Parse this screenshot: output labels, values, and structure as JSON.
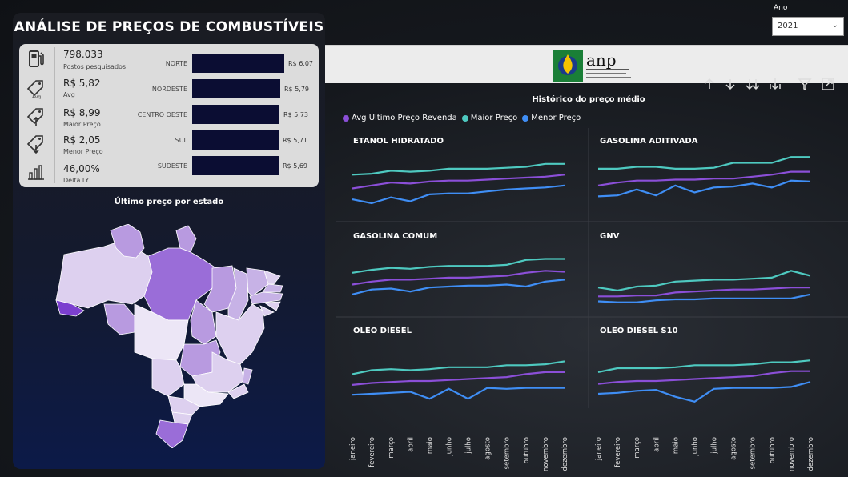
{
  "header": {
    "title": "ANÁLISE DE PREÇOS DE COMBUSTÍVEIS"
  },
  "year_filter": {
    "label": "Ano",
    "selected": "2021"
  },
  "kpis": [
    {
      "value": "798.033",
      "label": "Postos pesquisados",
      "icon": "fuel-pump-icon"
    },
    {
      "value": "R$ 5,82",
      "label": "Avg",
      "icon": "avg-price-tag-icon"
    },
    {
      "value": "R$ 8,99",
      "label": "Maior Preço",
      "icon": "price-up-tag-icon"
    },
    {
      "value": "R$ 2,05",
      "label": "Menor Preço",
      "icon": "price-down-tag-icon"
    },
    {
      "value": "46,00%",
      "label": "Delta LY",
      "icon": "bar-chart-icon"
    }
  ],
  "regions": [
    {
      "name": "NORTE",
      "value_label": "R$ 6,07",
      "value": 6.07
    },
    {
      "name": "NORDESTE",
      "value_label": "R$ 5,79",
      "value": 5.79
    },
    {
      "name": "CENTRO OESTE",
      "value_label": "R$ 5,73",
      "value": 5.73
    },
    {
      "name": "SUL",
      "value_label": "R$ 5,71",
      "value": 5.71
    },
    {
      "name": "SUDESTE",
      "value_label": "R$ 5,69",
      "value": 5.69
    }
  ],
  "map": {
    "title": "Último preço por estado"
  },
  "history": {
    "title": "Histórico do preço médio",
    "legend": [
      {
        "name": "Avg Ultimo Preço Revenda",
        "color": "#8b4fd8"
      },
      {
        "name": "Maior Preço",
        "color": "#4ec9c0"
      },
      {
        "name": "Menor Preço",
        "color": "#3f8ef5"
      }
    ],
    "months": [
      "janeiro",
      "fevereiro",
      "março",
      "abril",
      "maio",
      "junho",
      "julho",
      "agosto",
      "setembro",
      "outubro",
      "novembro",
      "dezembro"
    ]
  },
  "chart_data": [
    {
      "type": "line",
      "title": "ETANOL HIDRATADO",
      "x": [
        "janeiro",
        "fevereiro",
        "março",
        "abril",
        "maio",
        "junho",
        "julho",
        "agosto",
        "setembro",
        "outubro",
        "novembro",
        "dezembro"
      ],
      "series": [
        {
          "name": "Maior Preço",
          "values": [
            6.2,
            6.3,
            6.6,
            6.5,
            6.6,
            6.8,
            6.8,
            6.8,
            6.9,
            7.0,
            7.3,
            7.3
          ]
        },
        {
          "name": "Avg Ultimo Preço Revenda",
          "values": [
            4.8,
            5.1,
            5.4,
            5.3,
            5.5,
            5.6,
            5.6,
            5.7,
            5.8,
            5.9,
            6.0,
            6.2
          ]
        },
        {
          "name": "Menor Preço",
          "values": [
            3.7,
            3.3,
            3.9,
            3.5,
            4.2,
            4.3,
            4.3,
            4.5,
            4.7,
            4.8,
            4.9,
            5.1
          ]
        }
      ]
    },
    {
      "type": "line",
      "title": "GASOLINA ADITIVADA",
      "x": [
        "janeiro",
        "fevereiro",
        "março",
        "abril",
        "maio",
        "junho",
        "julho",
        "agosto",
        "setembro",
        "outubro",
        "novembro",
        "dezembro"
      ],
      "series": [
        {
          "name": "Maior Preço",
          "values": [
            6.8,
            6.8,
            7.0,
            7.0,
            6.8,
            6.8,
            6.9,
            7.4,
            7.4,
            7.4,
            8.0,
            8.0
          ]
        },
        {
          "name": "Avg Ultimo Preço Revenda",
          "values": [
            5.1,
            5.4,
            5.6,
            5.6,
            5.7,
            5.7,
            5.8,
            5.8,
            6.0,
            6.2,
            6.5,
            6.5
          ]
        },
        {
          "name": "Menor Preço",
          "values": [
            4.0,
            4.1,
            4.7,
            4.1,
            5.1,
            4.4,
            4.9,
            5.0,
            5.3,
            4.9,
            5.6,
            5.5
          ]
        }
      ]
    },
    {
      "type": "line",
      "title": "GASOLINA COMUM",
      "x": [
        "janeiro",
        "fevereiro",
        "março",
        "abril",
        "maio",
        "junho",
        "julho",
        "agosto",
        "setembro",
        "outubro",
        "novembro",
        "dezembro"
      ],
      "series": [
        {
          "name": "Maior Preço",
          "values": [
            6.0,
            6.3,
            6.5,
            6.4,
            6.6,
            6.7,
            6.7,
            6.7,
            6.8,
            7.3,
            7.4,
            7.4
          ]
        },
        {
          "name": "Avg Ultimo Preço Revenda",
          "values": [
            4.8,
            5.1,
            5.3,
            5.3,
            5.4,
            5.5,
            5.5,
            5.6,
            5.7,
            6.0,
            6.2,
            6.1
          ]
        },
        {
          "name": "Menor Preço",
          "values": [
            3.8,
            4.3,
            4.4,
            4.1,
            4.5,
            4.6,
            4.7,
            4.7,
            4.8,
            4.6,
            5.1,
            5.3
          ]
        }
      ]
    },
    {
      "type": "line",
      "title": "GNV",
      "x": [
        "janeiro",
        "fevereiro",
        "março",
        "abril",
        "maio",
        "junho",
        "julho",
        "agosto",
        "setembro",
        "outubro",
        "novembro",
        "dezembro"
      ],
      "series": [
        {
          "name": "Maior Preço",
          "values": [
            4.5,
            4.2,
            4.6,
            4.7,
            5.1,
            5.2,
            5.3,
            5.3,
            5.4,
            5.5,
            6.2,
            5.7
          ]
        },
        {
          "name": "Avg Ultimo Preço Revenda",
          "values": [
            3.6,
            3.6,
            3.7,
            3.7,
            4.0,
            4.1,
            4.2,
            4.3,
            4.3,
            4.4,
            4.5,
            4.5
          ]
        },
        {
          "name": "Menor Preço",
          "values": [
            3.1,
            3.0,
            3.0,
            3.2,
            3.3,
            3.3,
            3.4,
            3.4,
            3.4,
            3.4,
            3.4,
            3.8
          ]
        }
      ]
    },
    {
      "type": "line",
      "title": "OLEO DIESEL",
      "x": [
        "janeiro",
        "fevereiro",
        "março",
        "abril",
        "maio",
        "junho",
        "julho",
        "agosto",
        "setembro",
        "outubro",
        "novembro",
        "dezembro"
      ],
      "series": [
        {
          "name": "Maior Preço",
          "values": [
            5.3,
            5.7,
            5.8,
            5.7,
            5.8,
            6.0,
            6.0,
            6.0,
            6.2,
            6.2,
            6.3,
            6.6
          ]
        },
        {
          "name": "Avg Ultimo Preço Revenda",
          "values": [
            4.2,
            4.4,
            4.5,
            4.6,
            4.6,
            4.7,
            4.8,
            4.9,
            5.0,
            5.3,
            5.5,
            5.5
          ]
        },
        {
          "name": "Menor Preço",
          "values": [
            3.2,
            3.3,
            3.4,
            3.5,
            2.8,
            3.8,
            2.8,
            3.9,
            3.8,
            3.9,
            3.9,
            3.9
          ]
        }
      ]
    },
    {
      "type": "line",
      "title": "OLEO DIESEL S10",
      "x": [
        "janeiro",
        "fevereiro",
        "março",
        "abril",
        "maio",
        "junho",
        "julho",
        "agosto",
        "setembro",
        "outubro",
        "novembro",
        "dezembro"
      ],
      "series": [
        {
          "name": "Maior Preço",
          "values": [
            5.5,
            5.9,
            5.9,
            5.9,
            6.0,
            6.2,
            6.2,
            6.2,
            6.3,
            6.5,
            6.5,
            6.7
          ]
        },
        {
          "name": "Avg Ultimo Preço Revenda",
          "values": [
            4.3,
            4.5,
            4.6,
            4.6,
            4.7,
            4.8,
            4.9,
            5.0,
            5.1,
            5.4,
            5.6,
            5.6
          ]
        },
        {
          "name": "Menor Preço",
          "values": [
            3.3,
            3.4,
            3.6,
            3.7,
            3.0,
            2.5,
            3.8,
            3.9,
            3.9,
            3.9,
            4.0,
            4.5
          ]
        }
      ]
    }
  ]
}
